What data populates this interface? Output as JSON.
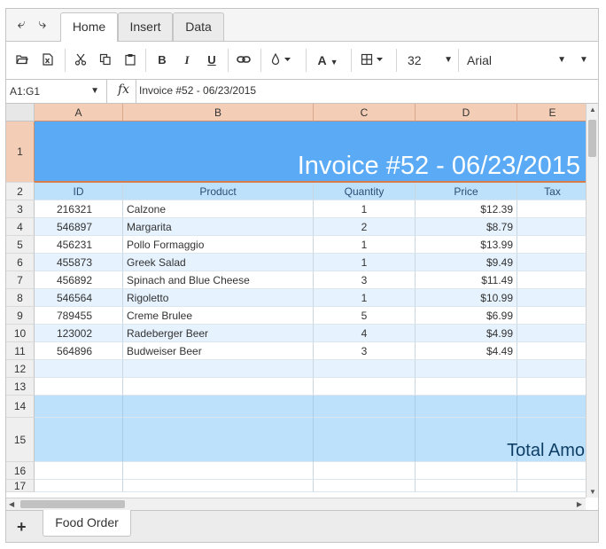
{
  "tabs": [
    {
      "label": "Home"
    },
    {
      "label": "Insert"
    },
    {
      "label": "Data"
    }
  ],
  "toolbar": {
    "bold": "B",
    "italic": "I",
    "underline": "U",
    "font_color_glyph": "A",
    "font_size": "32",
    "font_name": "Arial"
  },
  "formula_bar": {
    "name_box": "A1:G1",
    "fx": "fx",
    "formula": "Invoice #52 - 06/23/2015"
  },
  "columns": [
    "A",
    "B",
    "C",
    "D",
    "E"
  ],
  "rows": [
    "1",
    "2",
    "3",
    "4",
    "5",
    "6",
    "7",
    "8",
    "9",
    "10",
    "11",
    "12",
    "13",
    "14",
    "15",
    "16",
    "17"
  ],
  "title": "Invoice #52 - 06/23/2015",
  "headers": [
    "ID",
    "Product",
    "Quantity",
    "Price",
    "Tax"
  ],
  "items": [
    {
      "id": "216321",
      "product": "Calzone",
      "qty": "1",
      "price": "$12.39"
    },
    {
      "id": "546897",
      "product": "Margarita",
      "qty": "2",
      "price": "$8.79"
    },
    {
      "id": "456231",
      "product": "Pollo Formaggio",
      "qty": "1",
      "price": "$13.99"
    },
    {
      "id": "455873",
      "product": "Greek Salad",
      "qty": "1",
      "price": "$9.49"
    },
    {
      "id": "456892",
      "product": "Spinach and Blue Cheese",
      "qty": "3",
      "price": "$11.49"
    },
    {
      "id": "546564",
      "product": "Rigoletto",
      "qty": "1",
      "price": "$10.99"
    },
    {
      "id": "789455",
      "product": "Creme Brulee",
      "qty": "5",
      "price": "$6.99"
    },
    {
      "id": "123002",
      "product": "Radeberger Beer",
      "qty": "4",
      "price": "$4.99"
    },
    {
      "id": "564896",
      "product": "Budweiser Beer",
      "qty": "3",
      "price": "$4.49"
    }
  ],
  "total_label": "Total Amo",
  "sheets": [
    {
      "label": "Food Order"
    }
  ],
  "add_sheet": "+",
  "colors": {
    "title_bg": "#5aaaf6",
    "header_bg": "#bde0fb",
    "alt_row": "#e6f2fd",
    "col_header_bg": "#f3cdb5"
  }
}
